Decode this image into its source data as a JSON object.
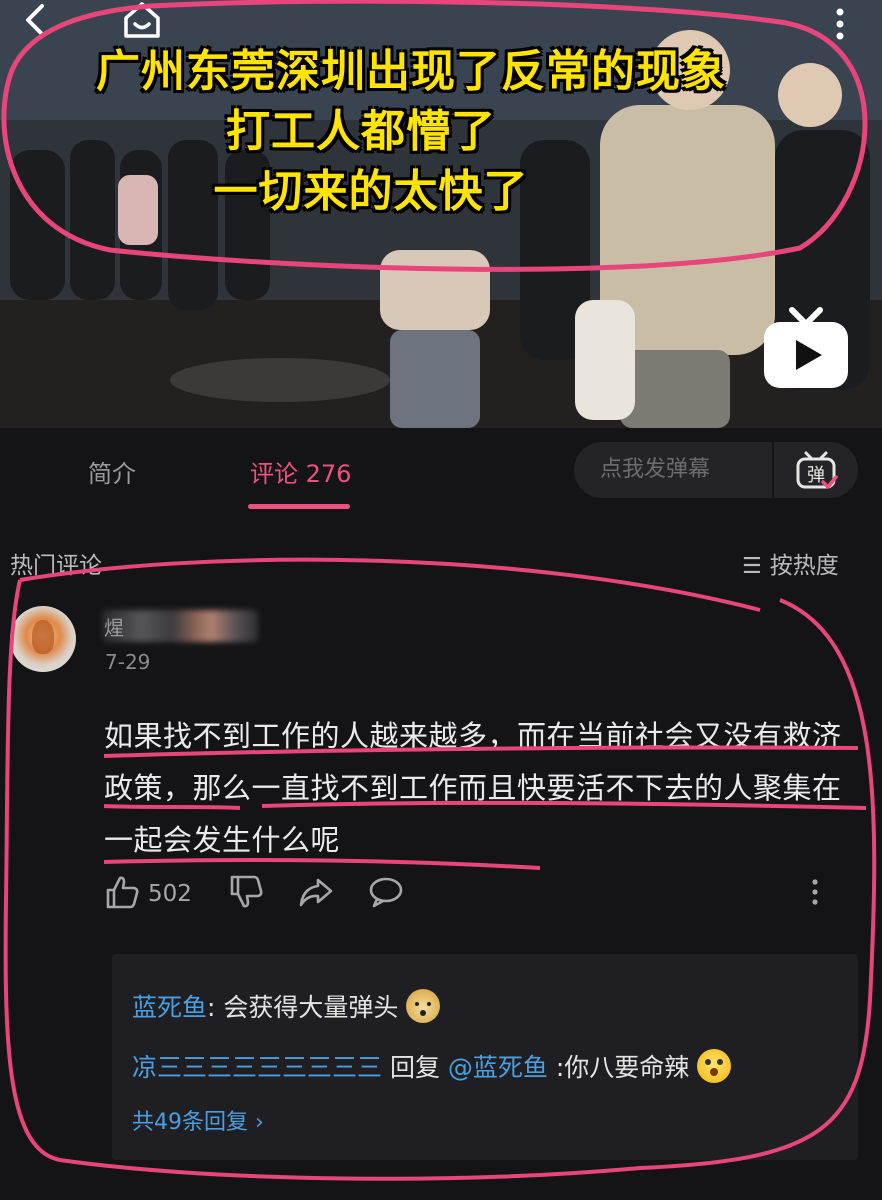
{
  "video": {
    "overlay_lines": [
      "广州东莞深圳出现了反常的现象",
      "打工人都懵了",
      "一切来的太快了"
    ]
  },
  "tabs": {
    "intro": "简介",
    "comments": "评论 276",
    "danmaku_placeholder": "点我发弹幕",
    "danmaku_btn": "弹"
  },
  "comments_header": {
    "hot": "热门评论",
    "sort": "按热度"
  },
  "comment": {
    "username": "煋",
    "date": "7-29",
    "text": "如果找不到工作的人越来越多，而在当前社会又没有救济政策，那么一直找不到工作而且快要活不下去的人聚集在一起会发生什么呢",
    "likes": "502"
  },
  "replies": {
    "r1_user": "蓝死鱼",
    "r1_text": ": 会获得大量弹头",
    "r2_user": "凉三三三三三三三三三",
    "r2_mid": " 回复 ",
    "r2_mention": "@蓝死鱼",
    "r2_text": " :你八要命辣",
    "view_all": "共49条回复 ›"
  },
  "colors": {
    "accent": "#f0507e",
    "link": "#4a9fe0",
    "marker": "#e8457a",
    "overlay_text": "#ffe400"
  },
  "icons": [
    "back-icon",
    "home-icon",
    "more-vertical-icon",
    "tv-play-icon",
    "danmaku-icon",
    "sort-icon",
    "thumbs-up-icon",
    "thumbs-down-icon",
    "share-icon",
    "reply-icon"
  ]
}
